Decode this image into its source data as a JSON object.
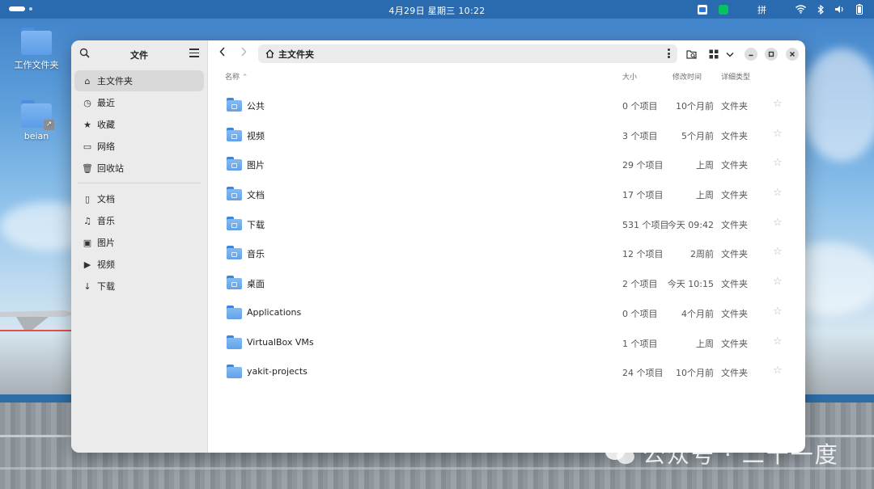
{
  "topbar": {
    "clock": "4月29日 星期三  10:22",
    "input_method": "拼"
  },
  "desktop": {
    "icons": [
      {
        "label": "工作文件夹"
      },
      {
        "label": "beian"
      }
    ]
  },
  "window": {
    "sidebar": {
      "title": "文件",
      "items_top": [
        {
          "label": "主文件夹",
          "icon": "home-icon"
        },
        {
          "label": "最近",
          "icon": "clock-icon"
        },
        {
          "label": "收藏",
          "icon": "star-icon"
        },
        {
          "label": "网络",
          "icon": "network-icon"
        },
        {
          "label": "回收站",
          "icon": "trash-icon"
        }
      ],
      "items_bottom": [
        {
          "label": "文档",
          "icon": "document-icon"
        },
        {
          "label": "音乐",
          "icon": "music-icon"
        },
        {
          "label": "图片",
          "icon": "picture-icon"
        },
        {
          "label": "视频",
          "icon": "video-icon"
        },
        {
          "label": "下载",
          "icon": "download-icon"
        }
      ]
    },
    "pathbar": {
      "label": "主文件夹"
    },
    "columns": {
      "name": "名称",
      "size": "大小",
      "modified": "修改时间",
      "type": "详细类型"
    },
    "files": [
      {
        "name": "公共",
        "size": "0 个项目",
        "modified": "10个月前",
        "type": "文件夹",
        "emblem": "share"
      },
      {
        "name": "视频",
        "size": "3 个项目",
        "modified": "5个月前",
        "type": "文件夹",
        "emblem": "video"
      },
      {
        "name": "图片",
        "size": "29 个项目",
        "modified": "上周",
        "type": "文件夹",
        "emblem": "picture"
      },
      {
        "name": "文档",
        "size": "17 个项目",
        "modified": "上周",
        "type": "文件夹",
        "emblem": "document"
      },
      {
        "name": "下载",
        "size": "531 个项目",
        "modified": "今天 09:42",
        "type": "文件夹",
        "emblem": "download"
      },
      {
        "name": "音乐",
        "size": "12 个项目",
        "modified": "2周前",
        "type": "文件夹",
        "emblem": "music"
      },
      {
        "name": "桌面",
        "size": "2 个项目",
        "modified": "今天 10:15",
        "type": "文件夹",
        "emblem": "desktop"
      },
      {
        "name": "Applications",
        "size": "0 个项目",
        "modified": "4个月前",
        "type": "文件夹",
        "emblem": ""
      },
      {
        "name": "VirtualBox VMs",
        "size": "1 个项目",
        "modified": "上周",
        "type": "文件夹",
        "emblem": ""
      },
      {
        "name": "yakit-projects",
        "size": "24 个项目",
        "modified": "10个月前",
        "type": "文件夹",
        "emblem": ""
      }
    ]
  },
  "watermark": {
    "text": "公众号 · 二十一度"
  },
  "colors": {
    "topbar": "#2a6bb0",
    "folder": "#62a1e9",
    "sidebar": "#ebebeb"
  }
}
